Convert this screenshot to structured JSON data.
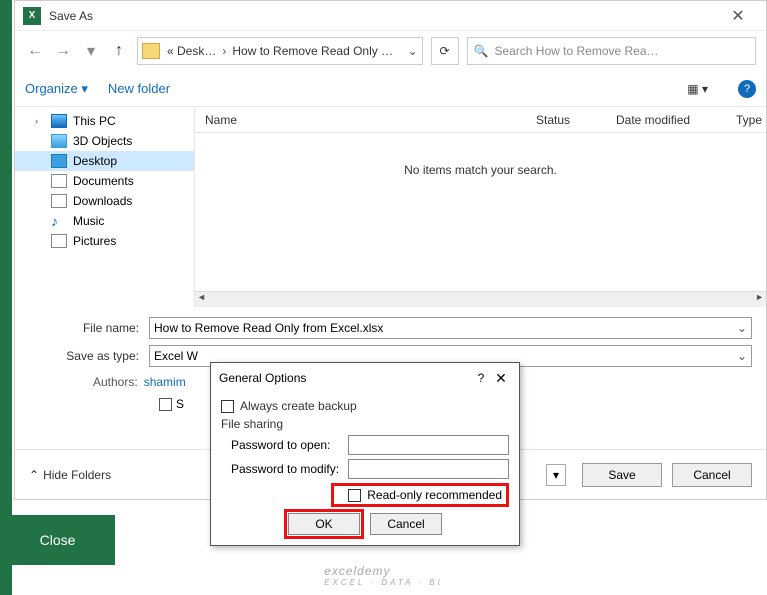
{
  "title": "Save As",
  "breadcrumb": {
    "p1": "« Desk…",
    "p2": "How to Remove Read Only …"
  },
  "search": {
    "placeholder": "Search How to Remove Rea…"
  },
  "toolbar": {
    "organize": "Organize ▾",
    "newfolder": "New folder"
  },
  "tree": {
    "pc": "This PC",
    "obj3d": "3D Objects",
    "desktop": "Desktop",
    "docs": "Documents",
    "dl": "Downloads",
    "music": "Music",
    "pics": "Pictures"
  },
  "cols": {
    "name": "Name",
    "status": "Status",
    "date": "Date modified",
    "type": "Type"
  },
  "empty": "No items match your search.",
  "form": {
    "filename_label": "File name:",
    "filename": "How to Remove Read Only from Excel.xlsx",
    "savetype_label": "Save as type:",
    "savetype": "Excel W",
    "authors_label": "Authors:",
    "authors": "shamim",
    "savethumb": "S"
  },
  "footer": {
    "hide": "Hide Folders",
    "save": "Save",
    "cancel": "Cancel"
  },
  "genopt": {
    "title": "General Options",
    "backup": "Always create backup",
    "filesharing": "File sharing",
    "pw_open": "Password to open:",
    "pw_modify": "Password to modify:",
    "readonly": "Read-only recommended",
    "ok": "OK",
    "cancel": "Cancel"
  },
  "close": "Close",
  "watermark": "exceldemy",
  "watermark_sub": "EXCEL · DATA · BI"
}
